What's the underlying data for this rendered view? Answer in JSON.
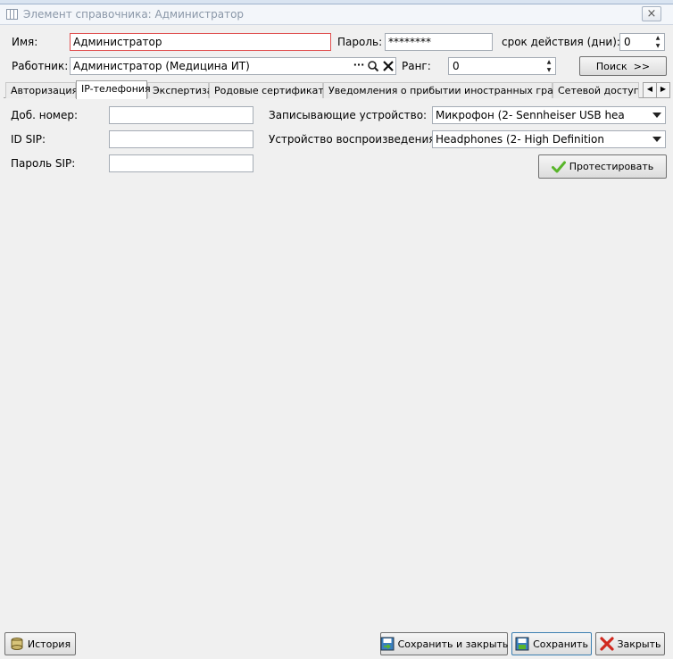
{
  "window": {
    "title": "Элемент справочника: Администратор",
    "close_glyph": "×"
  },
  "form": {
    "name_label": "Имя:",
    "name_value": "Администратор",
    "password_label": "Пароль:",
    "password_value": "********",
    "validity_label": "срок действия (дни):",
    "validity_value": "0",
    "worker_label": "Работник:",
    "worker_value": "Администратор (Медицина ИТ)",
    "worker_dots": "···",
    "rank_label": "Ранг:",
    "rank_value": "0",
    "search_button": "Поиск  >>"
  },
  "tabs": [
    {
      "label": "Авторизация"
    },
    {
      "label": "IP-телефония",
      "active": true
    },
    {
      "label": "Экспертиза"
    },
    {
      "label": "Родовые сертификаты"
    },
    {
      "label": "Уведомления о прибытии иностранных граждан"
    },
    {
      "label": "Сетевой доступ"
    }
  ],
  "tab_nav": {
    "prev": "◀",
    "next": "▶"
  },
  "ip": {
    "ext_label": "Доб. номер:",
    "ext_value": "",
    "sip_id_label": "ID SIP:",
    "sip_id_value": "",
    "sip_pass_label": "Пароль SIP:",
    "sip_pass_value": "",
    "rec_label": "Записывающие устройство:",
    "rec_value": "Микрофон (2- Sennheiser USB hea",
    "play_label": "Устройство воспроизведения:",
    "play_value": "Headphones (2- High Definition",
    "test_button": "Протестировать"
  },
  "bottom": {
    "history_button": "История",
    "save_close_button": "Сохранить и закрыть",
    "save_button": "Сохранить",
    "close_button": "Закрыть"
  },
  "colors": {
    "error_border": "#e05050",
    "check_green": "#58b52a",
    "close_red": "#d0281e"
  },
  "icons": [
    "window-icon",
    "search-icon",
    "clear-icon",
    "check-icon",
    "history-icon",
    "save-close-icon",
    "save-icon",
    "close-icon"
  ]
}
